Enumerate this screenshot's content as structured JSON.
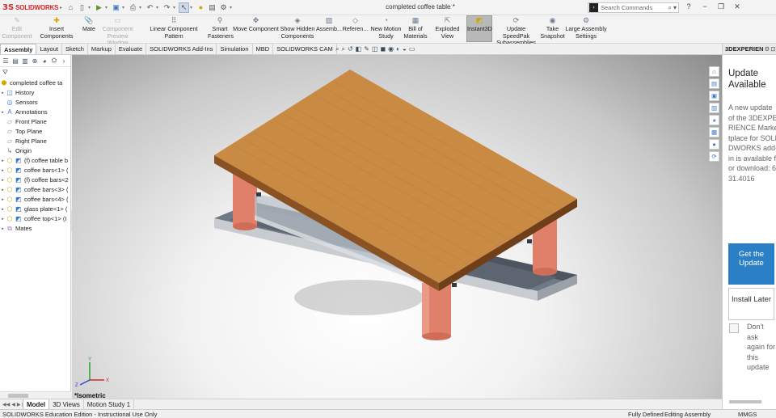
{
  "app": {
    "brand_ds": "3S",
    "brand_name": "SOLIDWORKS",
    "document_title": "completed coffee table *",
    "search_placeholder": "Search Commands"
  },
  "quick_access": [
    "home-icon",
    "new-icon",
    "open-icon",
    "save-icon",
    "print-icon",
    "undo-icon",
    "redo-icon",
    "select-icon",
    "rebuild-icon",
    "options-icon"
  ],
  "command_manager": [
    {
      "label": "Edit\nComponent",
      "icon": "edit-component-icon",
      "disabled": true
    },
    {
      "label": "Insert Components",
      "icon": "insert-components-icon",
      "disabled": false
    },
    {
      "label": "Mate",
      "icon": "mate-icon",
      "disabled": false
    },
    {
      "label": "Component\nPreview Window",
      "icon": "preview-window-icon",
      "disabled": true
    },
    {
      "label": "Linear Component Pattern",
      "icon": "linear-pattern-icon",
      "disabled": false
    },
    {
      "label": "Smart\nFasteners",
      "icon": "smart-fasteners-icon",
      "disabled": false
    },
    {
      "label": "Move Component",
      "icon": "move-component-icon",
      "disabled": false
    },
    {
      "label": "Show Hidden\nComponents",
      "icon": "show-hidden-icon",
      "disabled": false
    },
    {
      "label": "Assemb...",
      "icon": "assembly-features-icon",
      "disabled": false
    },
    {
      "label": "Referen...",
      "icon": "reference-geometry-icon",
      "disabled": false
    },
    {
      "label": "New Motion\nStudy",
      "icon": "motion-study-icon",
      "disabled": false
    },
    {
      "label": "Bill of\nMaterials",
      "icon": "bom-icon",
      "disabled": false
    },
    {
      "label": "Exploded View",
      "icon": "exploded-view-icon",
      "disabled": false
    },
    {
      "label": "Instant3D",
      "icon": "instant3d-icon",
      "disabled": false,
      "active": true
    },
    {
      "label": "Update SpeedPak\nSubassemblies",
      "icon": "speedpak-icon",
      "disabled": false
    },
    {
      "label": "Take\nSnapshot",
      "icon": "snapshot-icon",
      "disabled": false
    },
    {
      "label": "Large Assembly\nSettings",
      "icon": "large-assembly-icon",
      "disabled": false
    }
  ],
  "tabs": [
    "Assembly",
    "Layout",
    "Sketch",
    "Markup",
    "Evaluate",
    "SOLIDWORKS Add-Ins",
    "Simulation",
    "MBD",
    "SOLIDWORKS CAM"
  ],
  "active_tab": "Assembly",
  "feature_tree": [
    {
      "label": "completed coffee ta",
      "icon": "assembly-icon",
      "expand": false,
      "level": 0
    },
    {
      "label": "History",
      "icon": "history-icon",
      "expand": true,
      "level": 1
    },
    {
      "label": "Sensors",
      "icon": "sensors-icon",
      "expand": false,
      "level": 1
    },
    {
      "label": "Annotations",
      "icon": "annotations-icon",
      "expand": true,
      "level": 1
    },
    {
      "label": "Front Plane",
      "icon": "plane-icon",
      "expand": false,
      "level": 1
    },
    {
      "label": "Top Plane",
      "icon": "plane-icon",
      "expand": false,
      "level": 1
    },
    {
      "label": "Right Plane",
      "icon": "plane-icon",
      "expand": false,
      "level": 1
    },
    {
      "label": "Origin",
      "icon": "origin-icon",
      "expand": false,
      "level": 1
    },
    {
      "label": "(f) coffee table b",
      "icon": "part-icon",
      "expand": true,
      "level": 1
    },
    {
      "label": "coffee bars<1> (",
      "icon": "part-icon",
      "expand": true,
      "level": 1
    },
    {
      "label": "(f) coffee bars<2",
      "icon": "part-icon",
      "expand": true,
      "level": 1
    },
    {
      "label": "coffee bars<3> (",
      "icon": "part-icon",
      "expand": true,
      "level": 1
    },
    {
      "label": "coffee bars<4> (",
      "icon": "part-icon",
      "expand": true,
      "level": 1
    },
    {
      "label": "glass plate<1> (",
      "icon": "part-icon",
      "expand": true,
      "level": 1
    },
    {
      "label": "coffee top<1> (I",
      "icon": "part-icon",
      "expand": true,
      "level": 1
    },
    {
      "label": "Mates",
      "icon": "mates-icon",
      "expand": true,
      "level": 1
    }
  ],
  "viewport": {
    "view_name": "*Isometric",
    "triad_x": "X",
    "triad_y": "Y",
    "triad_z": "Z",
    "colors": {
      "wood": "#c98a44",
      "legs": "#e07f6a",
      "base": "#6b7480",
      "glass": "#b9c2c9"
    }
  },
  "bottom_tabs": [
    "Model",
    "3D Views",
    "Motion Study 1"
  ],
  "active_bottom_tab": "Model",
  "status": {
    "edition": "SOLIDWORKS Education Edition - Instructional Use Only",
    "state": "Fully Defined",
    "mode": "Editing Assembly",
    "units": "MMGS"
  },
  "task_pane": {
    "header": "3DEXPERIEN",
    "title": "Update Available",
    "body": "A new update of the 3DEXPERIENCE Marketplace for SOLIDWORKS add-in is available for download: 6.31.4016",
    "primary_button": "Get the Update",
    "secondary_button": "Install Later",
    "checkbox_label": "Don't ask again for this update"
  }
}
